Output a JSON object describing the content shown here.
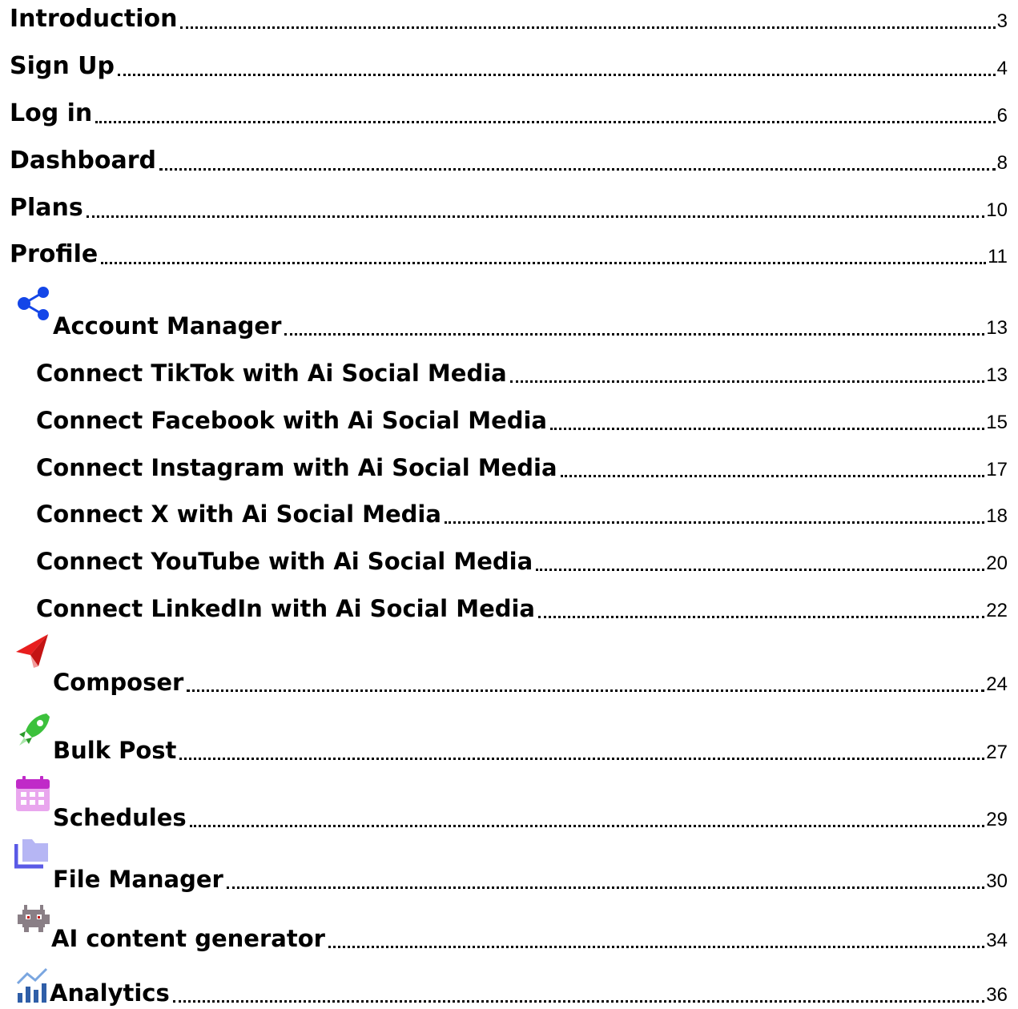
{
  "toc": {
    "introduction": {
      "title": "Introduction",
      "page": "3"
    },
    "sign_up": {
      "title": "Sign Up",
      "page": "4"
    },
    "log_in": {
      "title": "Log in",
      "page": "6"
    },
    "dashboard": {
      "title": "Dashboard",
      "page": "8"
    },
    "plans": {
      "title": "Plans",
      "page": "10"
    },
    "profile": {
      "title": "Profile",
      "page": "11"
    },
    "account_manager": {
      "title": "Account Manager",
      "page": "13",
      "icon": "share-icon"
    },
    "connect_tiktok": {
      "title": "Connect TikTok with Ai Social Media",
      "page": "13"
    },
    "connect_facebook": {
      "title": "Connect Facebook with Ai Social Media",
      "page": "15"
    },
    "connect_instagram": {
      "title": "Connect Instagram with Ai Social Media",
      "page": "17"
    },
    "connect_x": {
      "title": "Connect X with Ai Social Media",
      "page": "18"
    },
    "connect_youtube": {
      "title": "Connect YouTube with Ai Social Media",
      "page": "20"
    },
    "connect_linkedin": {
      "title": "Connect LinkedIn with Ai Social Media",
      "page": "22"
    },
    "composer": {
      "title": "Composer",
      "page": "24",
      "icon": "paper-plane-icon"
    },
    "bulk_post": {
      "title": "Bulk Post",
      "page": "27",
      "icon": "rocket-icon"
    },
    "schedules": {
      "title": "Schedules",
      "page": "29",
      "icon": "calendar-icon"
    },
    "file_manager": {
      "title": "File Manager",
      "page": "30",
      "icon": "folder-icon"
    },
    "ai_content_generator": {
      "title": "AI content generator",
      "page": "34",
      "icon": "alien-monster-icon"
    },
    "analytics": {
      "title": "Analytics",
      "page": "36",
      "icon": "chart-icon"
    }
  },
  "colors": {
    "share_icon": "#1446e8",
    "paper_plane_icon": "#e81e1e",
    "rocket_icon": "#3cc13c",
    "calendar_icon": "#c02ac8",
    "folder_icon": "#5a5ae6",
    "alien_monster_icon": "#8a7f86",
    "chart_icon": "#2f5ea8"
  }
}
